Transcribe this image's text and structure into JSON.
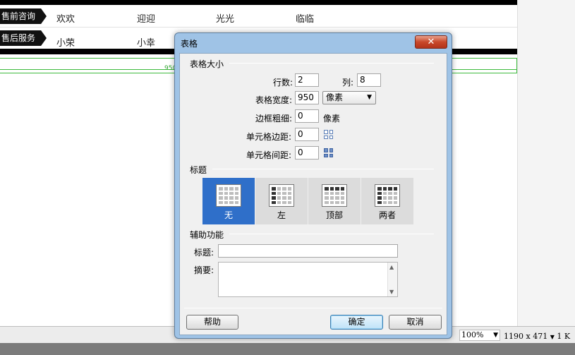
{
  "background_page": {
    "rows": [
      {
        "tag": "售前咨询",
        "names": [
          "欢欢",
          "迎迎",
          "光光",
          "临临"
        ]
      },
      {
        "tag": "售后服务",
        "names": [
          "小荣",
          "小幸"
        ]
      }
    ],
    "ruler_value": "950"
  },
  "status_bar": {
    "zoom": "100%",
    "size": "1190 x 471",
    "extra": "1 K"
  },
  "dialog": {
    "title": "表格",
    "close_symbol": "✕",
    "table_size": {
      "section_label": "表格大小",
      "rows_label": "行数:",
      "rows_value": "2",
      "cols_label": "列:",
      "cols_value": "8",
      "width_label": "表格宽度:",
      "width_value": "950",
      "width_unit": "像素",
      "border_label": "边框粗细:",
      "border_value": "0",
      "border_unit": "像素",
      "padding_label": "单元格边距:",
      "padding_value": "0",
      "spacing_label": "单元格间距:",
      "spacing_value": "0"
    },
    "header": {
      "section_label": "标题",
      "options": [
        {
          "label": "无",
          "selected": true
        },
        {
          "label": "左",
          "selected": false
        },
        {
          "label": "顶部",
          "selected": false
        },
        {
          "label": "两者",
          "selected": false
        }
      ]
    },
    "accessibility": {
      "section_label": "辅助功能",
      "caption_label": "标题:",
      "caption_value": "",
      "summary_label": "摘要:",
      "summary_value": ""
    },
    "buttons": {
      "help": "帮助",
      "ok": "确定",
      "cancel": "取消"
    }
  }
}
